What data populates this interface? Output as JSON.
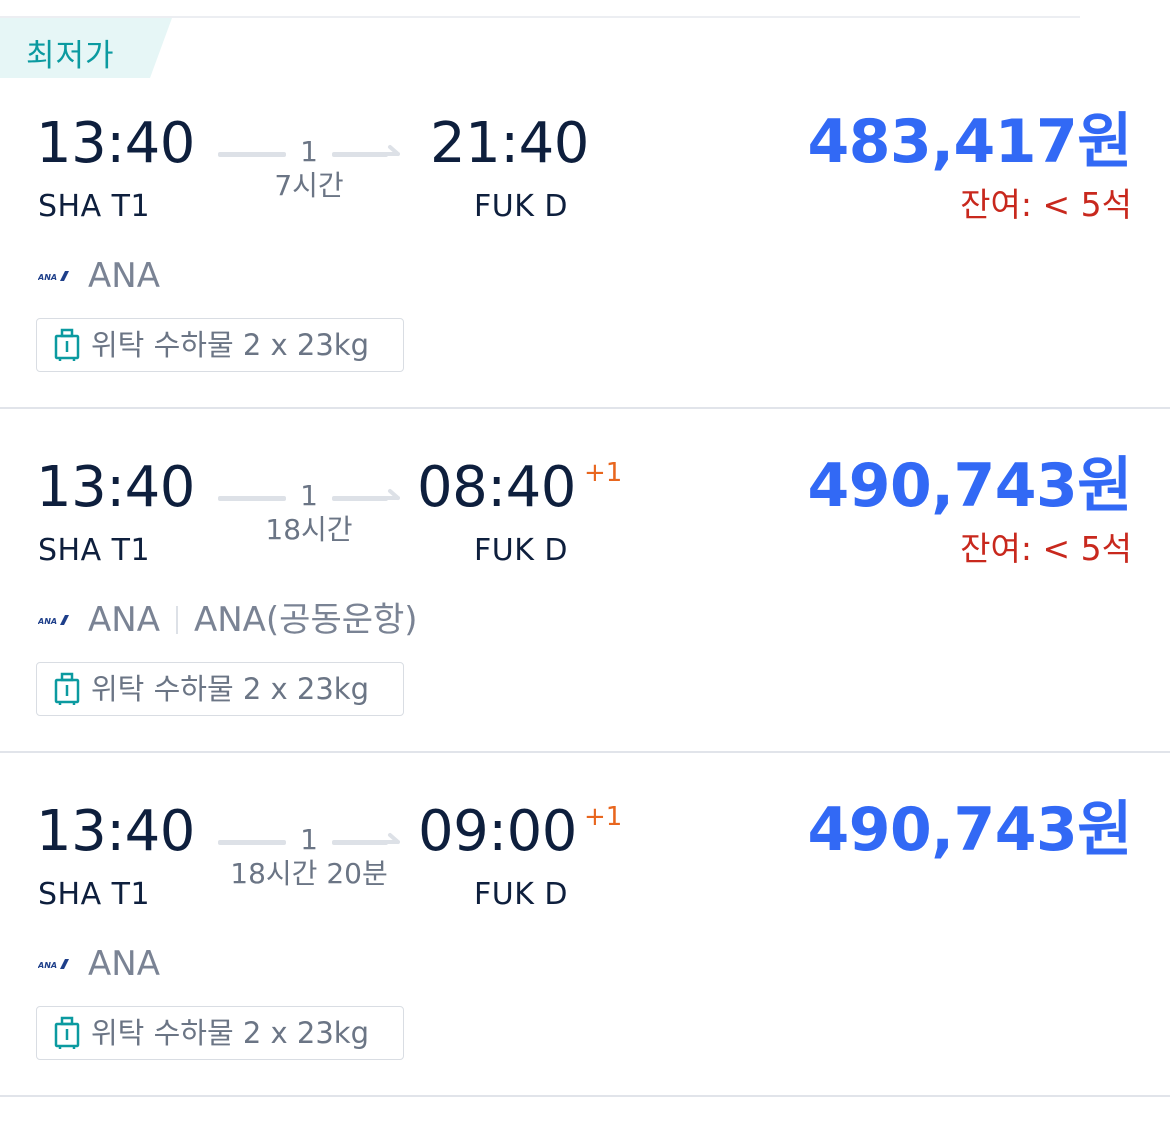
{
  "badge": {
    "label": "최저가"
  },
  "flights": [
    {
      "departure_time": "13:40",
      "departure_airport": "SHA T1",
      "stops": "1",
      "duration": "7시간",
      "arrival_time": "21:40",
      "day_offset": "",
      "arrival_airport": "FUK D",
      "price": "483,417원",
      "seats_left": "잔여: < 5석",
      "airline": "ANA",
      "codeshare": "",
      "baggage": "위탁 수하물 2 x 23kg"
    },
    {
      "departure_time": "13:40",
      "departure_airport": "SHA T1",
      "stops": "1",
      "duration": "18시간",
      "arrival_time": "08:40",
      "day_offset": "+1",
      "arrival_airport": "FUK D",
      "price": "490,743원",
      "seats_left": "잔여: < 5석",
      "airline": "ANA",
      "codeshare": "ANA(공동운항)",
      "baggage": "위탁 수하물 2 x 23kg"
    },
    {
      "departure_time": "13:40",
      "departure_airport": "SHA T1",
      "stops": "1",
      "duration": "18시간 20분",
      "arrival_time": "09:00",
      "day_offset": "+1",
      "arrival_airport": "FUK D",
      "price": "490,743원",
      "seats_left": "",
      "airline": "ANA",
      "codeshare": "",
      "baggage": "위탁 수하물 2 x 23kg"
    }
  ],
  "colors": {
    "badge_bg": "#e6f6f6",
    "badge_text": "#0b9aa0",
    "price": "#3269f5",
    "seats_warning": "#c8281d",
    "day_offset": "#e8661e",
    "primary_text": "#0e1f3d",
    "secondary_text": "#6b7585"
  },
  "icons": {
    "airline_logo": "ana-logo-icon",
    "baggage": "luggage-icon",
    "route_arrow": "arrow-right-icon"
  }
}
